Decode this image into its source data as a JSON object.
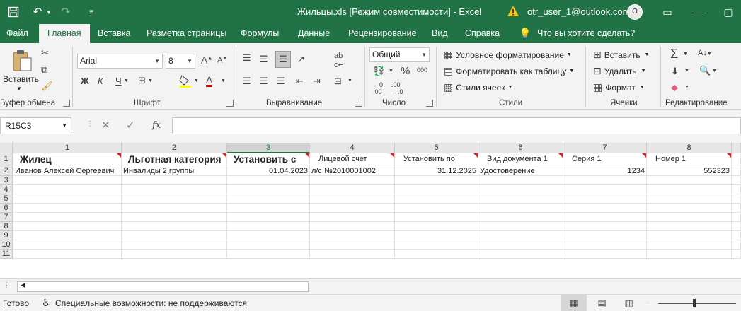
{
  "titlebar": {
    "title": "Жильцы.xls  [Режим совместимости]  -  Excel",
    "account": "otr_user_1@outlook.com",
    "avatar_label": "О"
  },
  "tabs": [
    "Файл",
    "Главная",
    "Вставка",
    "Разметка страницы",
    "Формулы",
    "Данные",
    "Рецензирование",
    "Вид",
    "Справка"
  ],
  "tell_me": "Что вы хотите сделать?",
  "ribbon": {
    "clipboard": {
      "paste": "Вставить",
      "label": "Буфер обмена"
    },
    "font": {
      "name": "Arial",
      "size": "8",
      "bold": "Ж",
      "italic": "К",
      "underline": "Ч",
      "label": "Шрифт"
    },
    "alignment": {
      "label": "Выравнивание"
    },
    "number": {
      "format": "Общий",
      "percent": "%",
      "thousands": "000",
      "label": "Число"
    },
    "styles": {
      "conditional": "Условное форматирование",
      "as_table": "Форматировать как таблицу",
      "cell_styles": "Стили ячеек",
      "label": "Стили"
    },
    "cells": {
      "insert": "Вставить",
      "delete": "Удалить",
      "format": "Формат",
      "label": "Ячейки"
    },
    "editing": {
      "label": "Редактирование"
    }
  },
  "formula_bar": {
    "name_box": "R15C3",
    "value": ""
  },
  "grid": {
    "columns": [
      "1",
      "2",
      "3",
      "4",
      "5",
      "6",
      "7",
      "8"
    ],
    "rows": [
      "1",
      "2",
      "3",
      "4",
      "5",
      "6",
      "7",
      "8",
      "9",
      "10",
      "11"
    ],
    "headers": [
      "Жилец",
      "Льготная категория",
      "Установить с",
      "Лицевой счет",
      "Установить по",
      "Вид документа 1",
      "Серия 1",
      "Номер 1"
    ],
    "row2": [
      "Иванов Алексей Сергеевич",
      "Инвалиды 2 группы",
      "01.04.2023",
      "л/с №2010001002",
      "31.12.2025",
      "Удостоверение",
      "1234",
      "552323"
    ]
  },
  "status": {
    "ready": "Готово",
    "accessibility": "Специальные возможности: не поддерживаются"
  }
}
